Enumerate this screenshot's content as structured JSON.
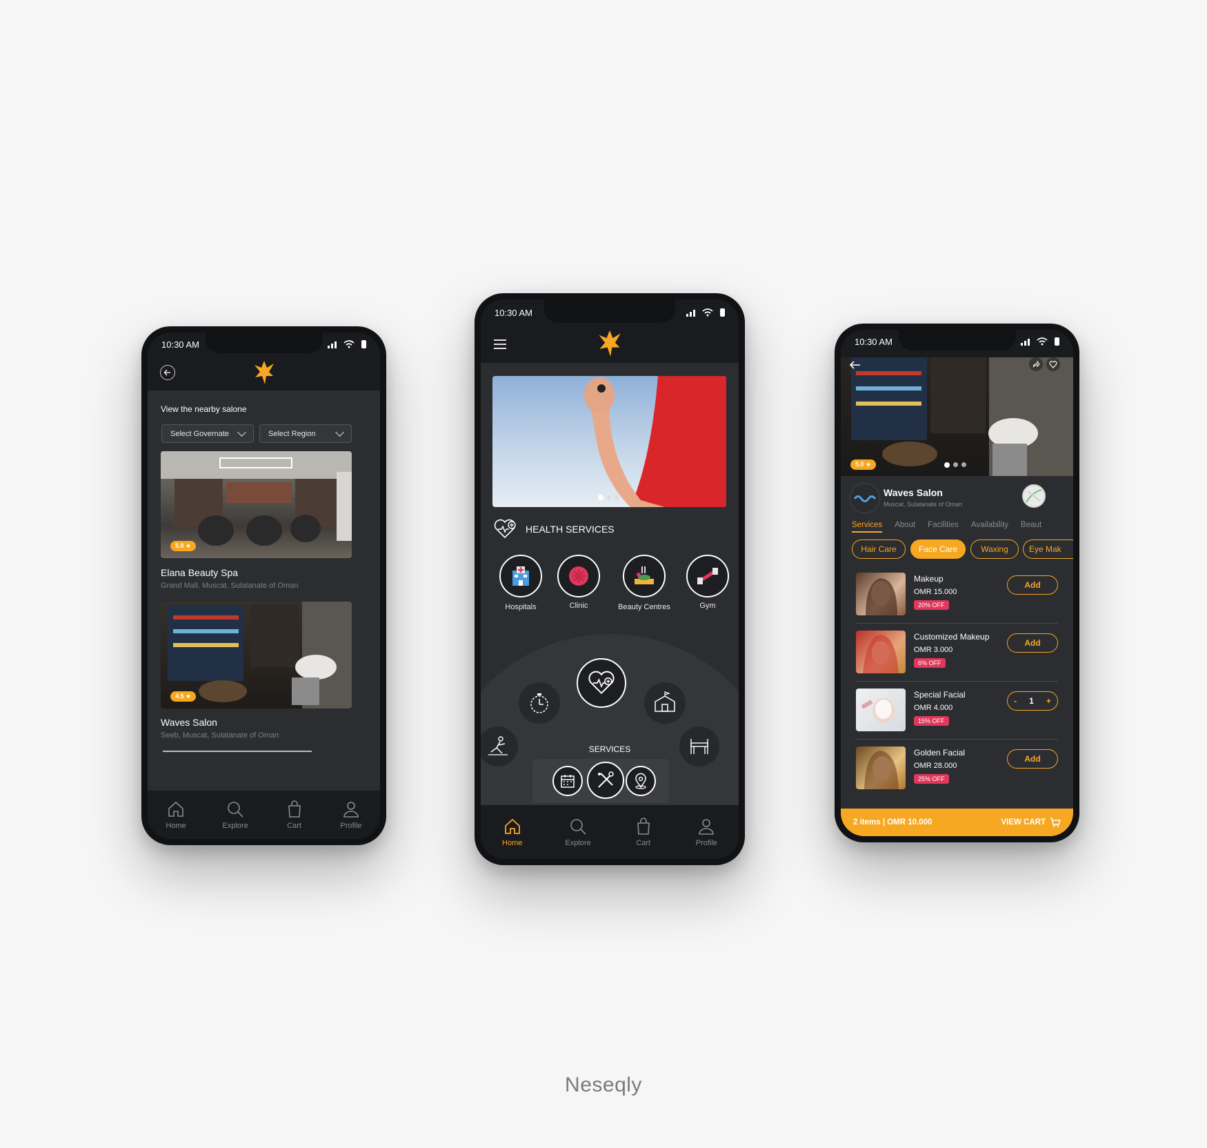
{
  "colors": {
    "accent": "#f7a823",
    "dark": "#2c2d30",
    "bar": "#1a1b1e",
    "discount": "#e0375b"
  },
  "status": {
    "time": "10:30 AM"
  },
  "nav": {
    "home": "Home",
    "explore": "Explore",
    "cart": "Cart",
    "profile": "Profile"
  },
  "left_screen": {
    "heading": "View the nearby salone",
    "governate_placeholder": "Select Governate",
    "region_placeholder": "Select Region",
    "listings": [
      {
        "name": "Elana Beauty Spa",
        "address": "Grand Mall, Muscat, Sulatanate of Oman",
        "rating": "5.0 ★"
      },
      {
        "name": "Waves Salon",
        "address": "Seeb, Muscat, Sulatanate of Oman",
        "rating": "4.5 ★"
      }
    ]
  },
  "center_screen": {
    "section_title": "HEALTH SERVICES",
    "categories": [
      {
        "label": "Hospitals",
        "icon": "hospital-icon"
      },
      {
        "label": "Clinic",
        "icon": "clinic-icon"
      },
      {
        "label": "Beauty Centres",
        "icon": "beauty-centre-icon"
      },
      {
        "label": "Gym",
        "icon": "dumbbell-icon"
      }
    ],
    "services_label": "SERVICES"
  },
  "right_screen": {
    "rating": "5.0 ★",
    "salon_name": "Waves Salon",
    "salon_address": "Muscat, Sulatanate of Oman",
    "tabs": [
      "Services",
      "About",
      "Facilities",
      "Availability",
      "Beaut"
    ],
    "filters": [
      "Hair Care",
      "Face Care",
      "Waxing",
      "Eye Mak"
    ],
    "services": [
      {
        "name": "Makeup",
        "price": "OMR 15.000",
        "off": "20% OFF",
        "action": "Add"
      },
      {
        "name": "Customized Makeup",
        "price": "OMR 3.000",
        "off": "6% OFF",
        "action": "Add"
      },
      {
        "name": "Special Facial",
        "price": "OMR 4.000",
        "off": "15% OFF",
        "qty": "1",
        "minus": "-",
        "plus": "+"
      },
      {
        "name": "Golden Facial",
        "price": "OMR 28.000",
        "off": "25% OFF",
        "action": "Add"
      }
    ],
    "cart_summary": "2 items | OMR 10.000",
    "view_cart": "VIEW CART"
  },
  "brand_caption": "Neseqly"
}
